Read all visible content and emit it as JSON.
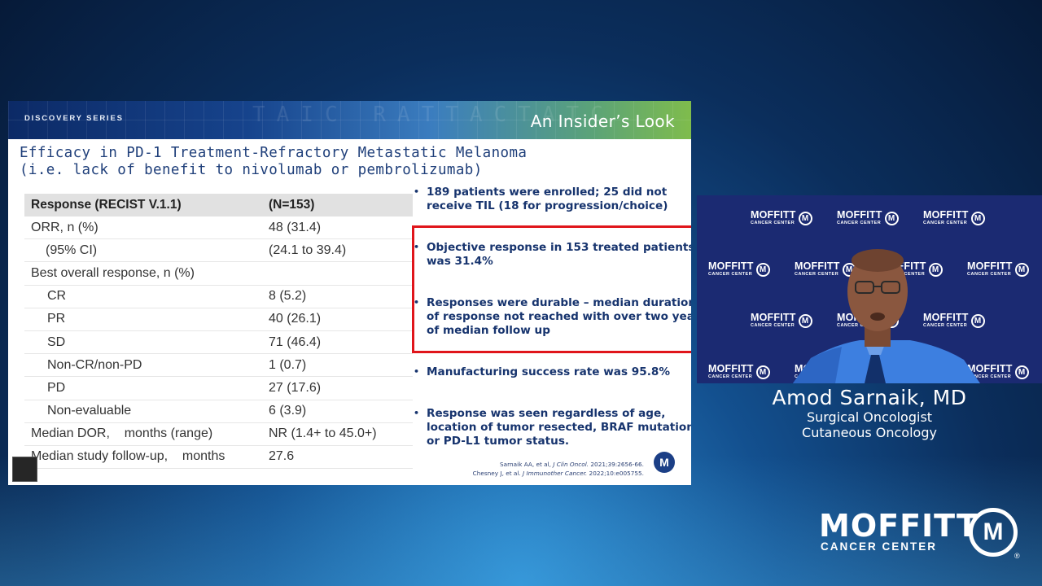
{
  "slide": {
    "series_label": "DISCOVERY SERIES",
    "header_title": "An Insider’s Look",
    "title_line1": "Efficacy in PD-1 Treatment-Refractory Metastatic Melanoma",
    "title_line2": "(i.e. lack of benefit to nivolumab or pembrolizumab)",
    "table": {
      "headers": [
        "Response (RECIST V.1.1)",
        "(N=153)"
      ],
      "rows": [
        {
          "label": "ORR, n (%)",
          "value": "48 (31.4)"
        },
        {
          "label": "(95% CI)",
          "value": "(24.1 to 39.4)"
        },
        {
          "label": "Best overall response, n (%)",
          "value": ""
        },
        {
          "label": "CR",
          "value": "8 (5.2)"
        },
        {
          "label": "PR",
          "value": "40 (26.1)"
        },
        {
          "label": "SD",
          "value": "71 (46.4)"
        },
        {
          "label": "Non-CR/non-PD",
          "value": "1 (0.7)"
        },
        {
          "label": "PD",
          "value": "27 (17.6)"
        },
        {
          "label": "Non-evaluable",
          "value": "6 (3.9)"
        },
        {
          "label": "Median DOR,    months (range)",
          "value": "NR (1.4+ to 45.0+)"
        },
        {
          "label": "Median study follow-up,    months",
          "value": "27.6"
        }
      ]
    },
    "bullets": [
      {
        "lines": [
          "189 patients were enrolled; 25 did not",
          "receive TIL (18 for progression/choice)"
        ]
      },
      {
        "lines": [
          "Objective response in 153 treated patients",
          "was 31.4%"
        ]
      },
      {
        "lines": [
          "Responses were durable – median duration",
          "of response not reached with over two years",
          "of median follow up"
        ]
      },
      {
        "lines": [
          "Manufacturing success rate was 95.8%"
        ]
      },
      {
        "lines": [
          "Response was seen regardless of age,",
          "location of tumor resected, BRAF mutational",
          "or PD-L1 tumor status."
        ]
      }
    ],
    "references": {
      "ref1_authors": "Sarnaik AA, et al, ",
      "ref1_journal": "J Clin Oncol.",
      "ref1_cite": " 2021;39:2656-66.",
      "ref2_authors": "Chesney J, et al. ",
      "ref2_journal": "J Immunother Cancer.",
      "ref2_cite": " 2022;10:e005755."
    },
    "logo_glyph": "M"
  },
  "video": {
    "watermark_word": "MOFFITT",
    "watermark_sub": "CANCER CENTER",
    "watermark_glyph": "M"
  },
  "speaker": {
    "name": "Amod Sarnaik, MD",
    "title1": "Surgical Oncologist",
    "title2": "Cutaneous Oncology"
  },
  "brand": {
    "word": "MOFFITT",
    "sub": "CANCER CENTER",
    "glyph": "M",
    "trademark": "®"
  },
  "colors": {
    "slide_navy": "#17346e",
    "highlight_red": "#e0151b",
    "video_backdrop": "#1b2a72"
  }
}
